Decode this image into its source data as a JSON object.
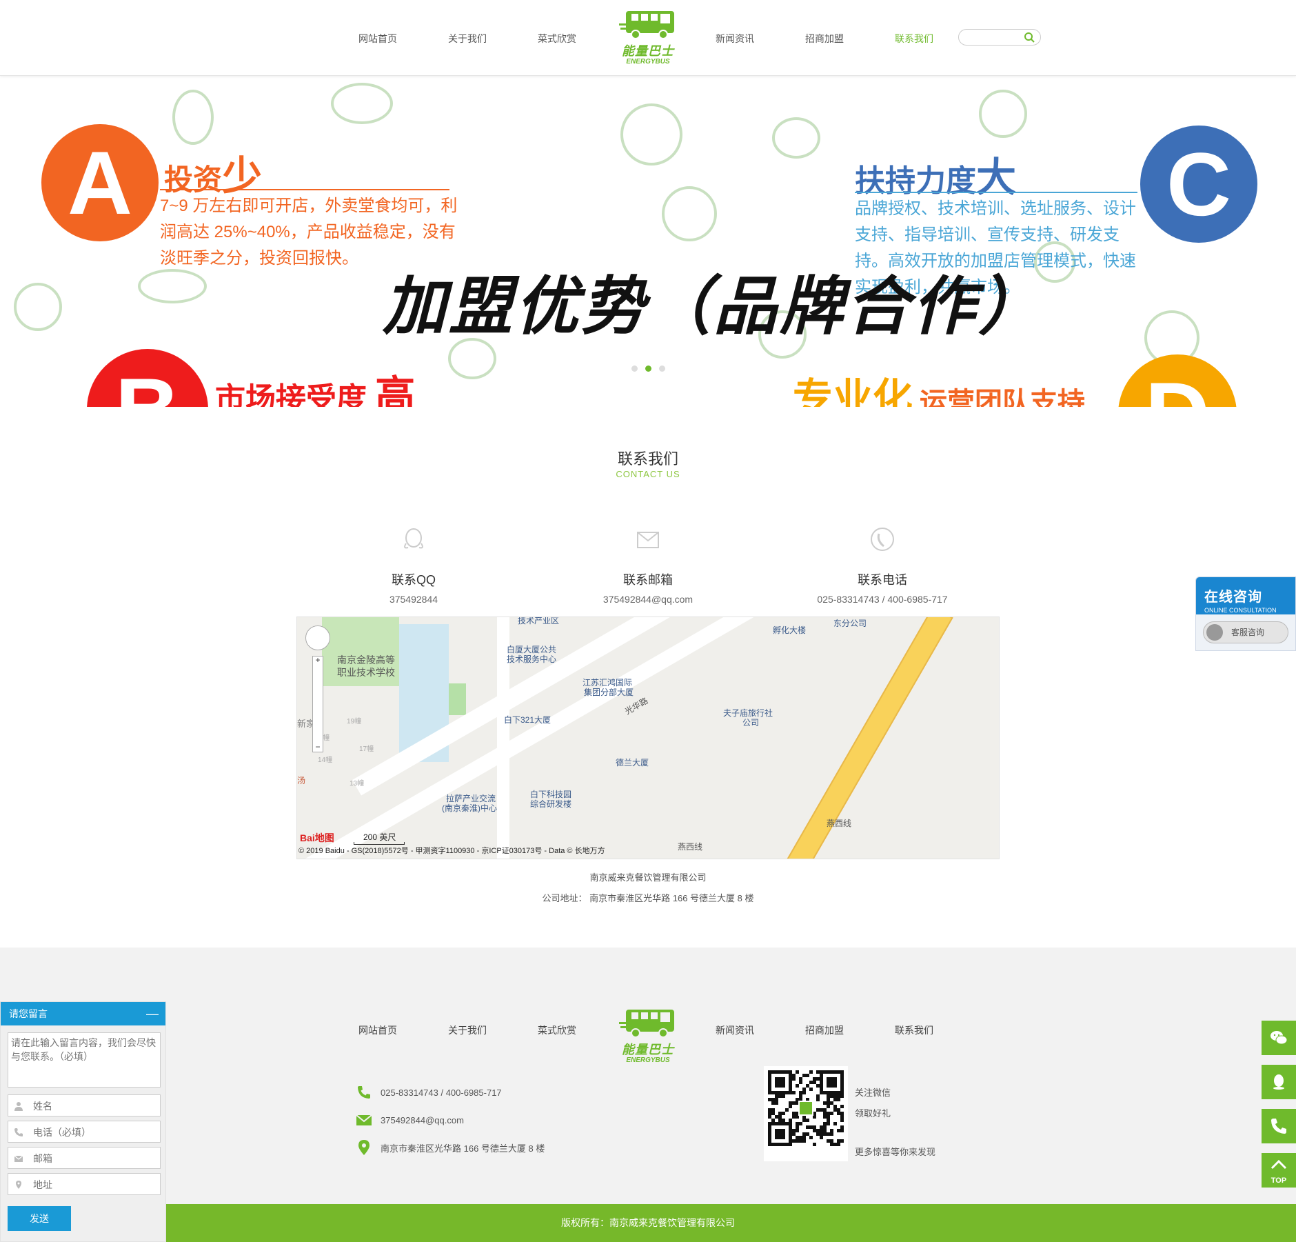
{
  "nav": {
    "items": [
      "网站首页",
      "关于我们",
      "菜式欣赏",
      "新闻资讯",
      "招商加盟",
      "联系我们"
    ],
    "active": "联系我们",
    "search_placeholder": ""
  },
  "logo": {
    "name": "能量巴士",
    "sub": "ENERGYBUS"
  },
  "banner": {
    "title": "加盟优势（品牌合作）",
    "a": {
      "letter": "A",
      "head": "投资",
      "head_big": "少",
      "body": "7~9 万左右即可开店，外卖堂食均可，利润高达 25%~40%，产品收益稳定，没有淡旺季之分，投资回报快。",
      "color": "#f26522"
    },
    "b": {
      "letter": "B",
      "head": "市场接受度",
      "head_big": "高",
      "color": "#ee1c1c"
    },
    "c": {
      "letter": "C",
      "head": "扶持力度",
      "head_big": "大",
      "body": "品牌授权、技术培训、选址服务、设计支持、指导培训、宣传支持、研发支持。高效开放的加盟店管理模式，快速实现盈利，共赢市场。",
      "color": "#3d6fb7",
      "body_color": "#4aa6d6"
    },
    "d": {
      "letter": "D",
      "head": "专业化",
      "head_small": "运营团队支持",
      "color": "#f7a600"
    },
    "active_slide": 2,
    "slide_count": 2
  },
  "contact": {
    "title": "联系我们",
    "subtitle": "CONTACT US",
    "items": [
      {
        "label": "联系QQ",
        "value": "375492844",
        "icon": "qq-icon"
      },
      {
        "label": "联系邮箱",
        "value": "375492844@qq.com",
        "icon": "mail-icon"
      },
      {
        "label": "联系电话",
        "value": "025-83314743  /  400-6985-717",
        "icon": "phone-icon"
      }
    ],
    "company": "南京威来克餐饮管理有限公司",
    "address_label": "公司地址：",
    "address": "南京市秦淮区光华路 166 号德兰大厦 8 楼"
  },
  "map": {
    "labels": [
      "南京金陵高等",
      "职业技术学校",
      "白厦大厦公共",
      "技术服务中心",
      "江苏汇鸿国际",
      "集团分部大厦",
      "白下321大厦",
      "德兰大厦",
      "夫子庙旅行社",
      "公司",
      "拉萨产业交流",
      "(南京秦淮)中心",
      "白下科技园",
      "综合研发楼",
      "光华路",
      "燕西线",
      "孵化大楼",
      "东分公司",
      "新家园",
      "技术产业区",
      "19幢",
      "16幢",
      "14幢",
      "13幢",
      "17幢",
      "汤",
      "燕西线"
    ],
    "scale": "200 英尺",
    "copyright": "© 2019 Baidu - GS(2018)5572号 - 甲测资字1100930 - 京ICP证030173号 - Data © 长地万方",
    "brand": "Bai地图"
  },
  "footer": {
    "nav": [
      "网站首页",
      "关于我们",
      "菜式欣赏",
      "新闻资讯",
      "招商加盟",
      "联系我们"
    ],
    "phone": "025-83314743 / 400-6985-717",
    "email": "375492844@qq.com",
    "address": "南京市秦淮区光华路 166 号德兰大厦 8 楼",
    "qr_text1": "关注微信",
    "qr_text2": "领取好礼",
    "qr_text3": "更多惊喜等你来发现",
    "copyright": "版权所有：南京威来克餐饮管理有限公司"
  },
  "online": {
    "title": "在线咨询",
    "sub": "ONLINE CONSULTATION",
    "button": "客服咨询"
  },
  "message": {
    "header": "请您留言",
    "content_placeholder": "请在此输入留言内容，我们会尽快与您联系。（必填）",
    "name_placeholder": "姓名",
    "phone_placeholder": "电话（必填）",
    "email_placeholder": "邮箱",
    "address_placeholder": "地址",
    "send": "发送"
  },
  "side": {
    "top_label": "TOP"
  },
  "colors": {
    "green": "#6fba2c",
    "blue": "#1a9ad6"
  }
}
